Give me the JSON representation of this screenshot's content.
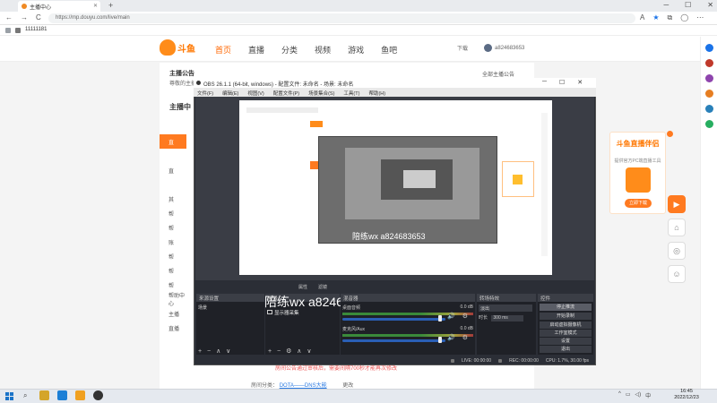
{
  "browser": {
    "tab_title": "主播中心",
    "url": "https://mp.douyu.com/live/main",
    "bookmark": "11111181",
    "nav_back": "←",
    "nav_forward": "→",
    "nav_reload": "C"
  },
  "douyu": {
    "logo_text": "斗鱼",
    "nav": [
      "首页",
      "直播",
      "分类",
      "视频",
      "游戏",
      "鱼吧"
    ],
    "download": "下载",
    "username": "a824683653",
    "announcement_title": "主播公告",
    "announcement_text": "尊敬的主播：",
    "all_announcements": "全部主播公告",
    "sidebar_title": "主播中",
    "sidebar_items": [
      "",
      "直",
      "",
      "直",
      "",
      "其"
    ],
    "sidebar_more": [
      "帮",
      "帮",
      "账",
      "帮",
      "帮",
      "帮"
    ],
    "side_bottom": [
      "帮助中心",
      "主播",
      "直播"
    ],
    "bottom_notice": "房间公告通过审核后，需要间隔700秒才能再次修改",
    "bottom_label": "房间分类：",
    "bottom_link": "DOTA——DNS大能",
    "bottom_extra": "更改"
  },
  "promo": {
    "title": "斗鱼直播伴侣",
    "subtitle": "提供官方PC端直播工具",
    "button": "立即下载"
  },
  "obs": {
    "title": "OBS 26.1.1 (64-bit, windows) - 配置文件: 未命名 - 场景: 未命名",
    "menu": [
      "文件(F)",
      "编辑(E)",
      "视图(V)",
      "配置文件(P)",
      "场景集合(S)",
      "工具(T)",
      "帮助(H)"
    ],
    "dock_tabs": [
      "属性",
      "滤镜"
    ],
    "scenes_head": "来源设置",
    "scene_label": "场景",
    "sources_head": "场景",
    "source_item": "显示器采集",
    "mixer_head": "混音器",
    "mixer_rows": [
      {
        "name": "桌面音频",
        "db": "0.0 dB"
      },
      {
        "name": "麦克风/Aux",
        "db": "0.0 dB"
      }
    ],
    "transition_head": "转场特效",
    "transition_select": "淡出",
    "duration_label": "时长",
    "duration_value": "300 ms",
    "controls_head": "控件",
    "controls": [
      "停止推流",
      "开始录制",
      "启动虚拟摄像机",
      "工作室模式",
      "设置",
      "退出"
    ],
    "status": {
      "live": "LIVE: 00:00:00",
      "rec": "REC: 00:00:00",
      "cpu": "CPU: 1.7%, 30.00 fps"
    },
    "watermark": "陪练wx  a824683653",
    "toolbar_scene": "+ − ∧ ∨",
    "toolbar_src": "+ − ⚙ ∧ ∨"
  },
  "taskbar": {
    "time": "16:45",
    "date": "2022/12/23"
  }
}
